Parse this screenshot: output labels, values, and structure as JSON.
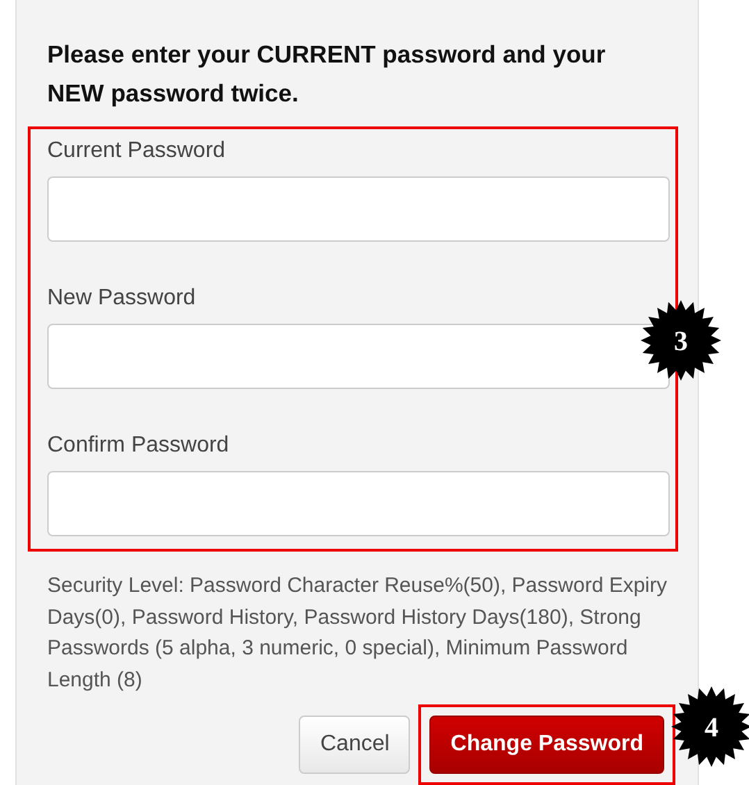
{
  "instructions": "Please enter your CURRENT password and your NEW password twice.",
  "fields": [
    {
      "label": "Current Password"
    },
    {
      "label": "New Password"
    },
    {
      "label": "Confirm Password"
    }
  ],
  "security_text": "Security Level: Password Character Reuse%(50), Password Expiry Days(0), Password History, Password History Days(180), Strong Passwords (5 alpha, 3 numeric, 0 special), Minimum Password Length (8)",
  "buttons": [
    {
      "label": "Cancel",
      "kind": "secondary"
    },
    {
      "label": "Change Password",
      "kind": "primary"
    }
  ],
  "callouts": [
    {
      "number": "3",
      "kind": "fields"
    },
    {
      "number": "4",
      "kind": "submit"
    }
  ]
}
